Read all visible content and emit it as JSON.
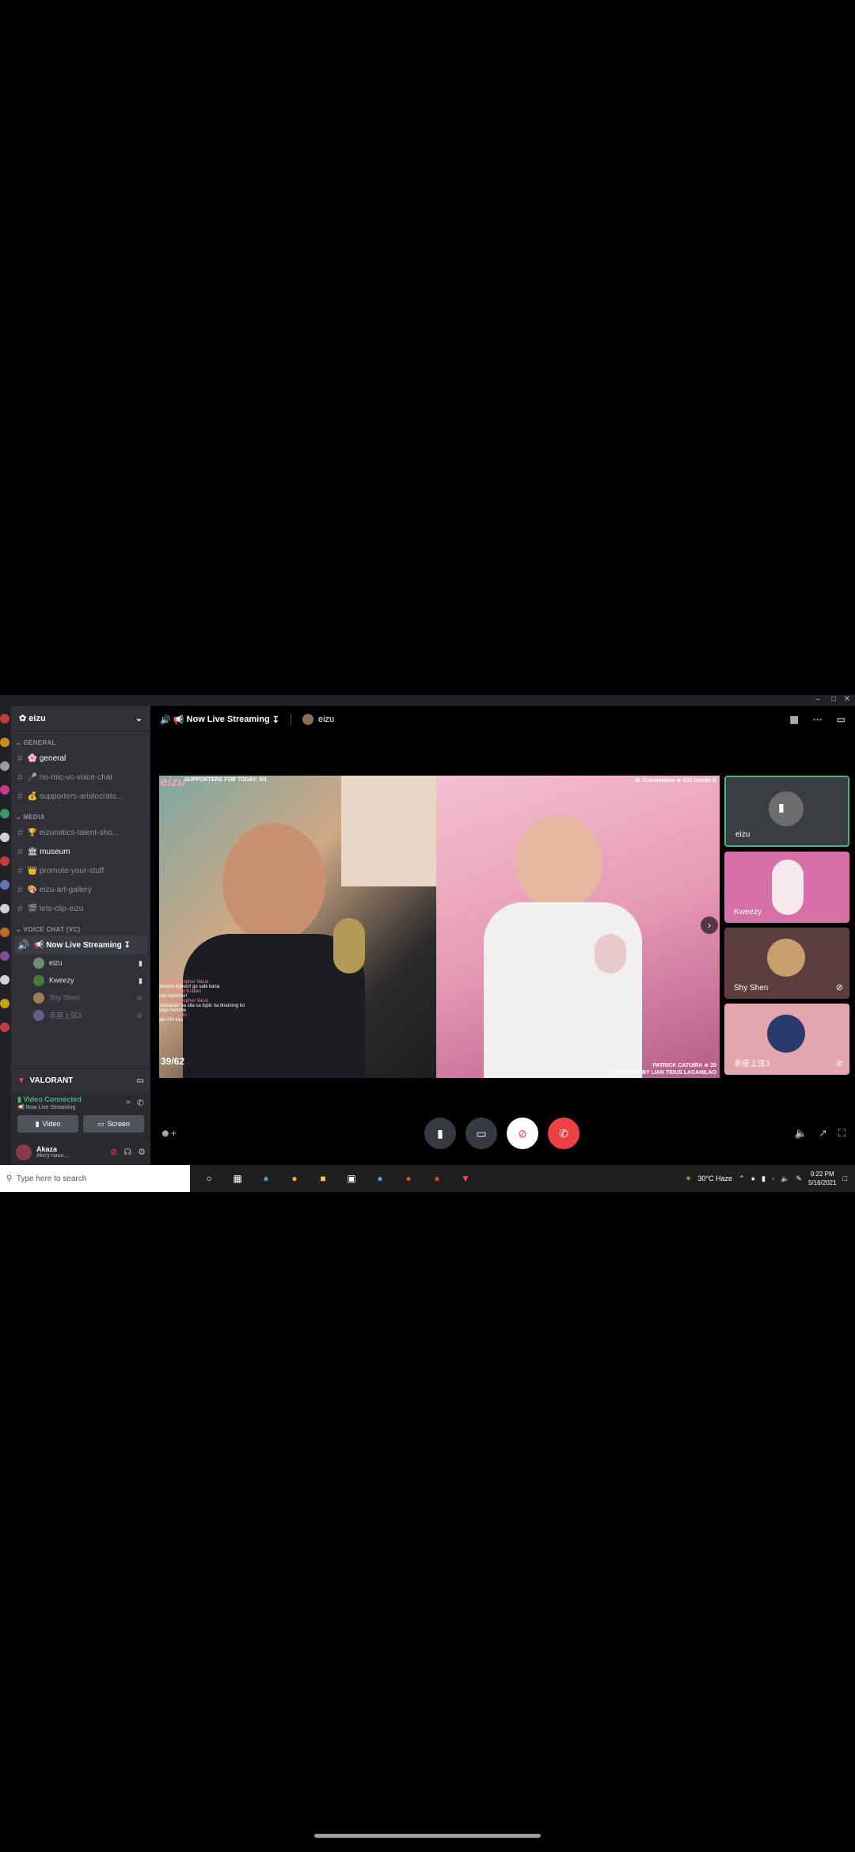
{
  "window": {
    "controls": [
      "–",
      "□",
      "✕"
    ]
  },
  "guild": {
    "name": "eizu"
  },
  "categories": {
    "general": "GENERAL",
    "media": "MEDIA",
    "voice": "VOICE CHAT (VC)"
  },
  "channels_general": [
    {
      "label": "general",
      "emoji": "🌸"
    },
    {
      "label": "no-mic-vc-voice-chat",
      "emoji": "🎤"
    },
    {
      "label": "supporters-aristocrats...",
      "emoji": "💰"
    }
  ],
  "channels_media": [
    {
      "label": "eizunatics-talent-sho...",
      "emoji": "🏆"
    },
    {
      "label": "museum",
      "emoji": "🏛"
    },
    {
      "label": "promote-your-stuff",
      "emoji": "👑"
    },
    {
      "label": "eizu-art-gallery",
      "emoji": "🎨"
    },
    {
      "label": "lets-clip-eizu",
      "emoji": "🎬"
    }
  ],
  "voice_channel": {
    "label": "Now Live Streaming"
  },
  "voice_users": [
    {
      "name": "eizu"
    },
    {
      "name": "Kweezy"
    },
    {
      "name": "Shy Shen"
    },
    {
      "name": "赤座上弦3"
    }
  ],
  "game": {
    "name": "VALORANT"
  },
  "voice_panel": {
    "status": "Video Connected",
    "channel": "Now Live Streaming",
    "video_label": "Video",
    "screen_label": "Screen"
  },
  "user": {
    "name": "Akaza",
    "status": "Ako'y nauu..."
  },
  "main": {
    "channel_title": "Now Live Streaming",
    "streamer": "eizu"
  },
  "stream_overlay": {
    "brand": "eizu",
    "supporters": "SUPPORTERS FOR TODAY: 0/1",
    "top_right": "M. Constantino ★ 235    Dustin B.",
    "counter": "39/62",
    "cheer": "CHEERED BY LIAN TIDUS LACANILAO",
    "cheer_name": "PATRICK CATUIRA ★ 20",
    "chat": [
      {
        "name": "John Christopher Vacal",
        "msg": "sinnnei kraken! go sabi kana"
      },
      {
        "name": "Kraaaahead Kraken",
        "msg": "ban hammer!"
      },
      {
        "name": "John Christopher Vacal",
        "msg": "sumasabi na sila sa topic na tinanong ko sayo hehehe"
      },
      {
        "name": "Jayvee Sotto",
        "msg": "ate PM kita"
      }
    ]
  },
  "tiles": [
    {
      "name": "eizu",
      "muted": false,
      "bg": "#3a3d42"
    },
    {
      "name": "Kweezy",
      "muted": false,
      "bg": "#d76fa8"
    },
    {
      "name": "Shy Shen",
      "muted": true,
      "bg": "#5b3e3d"
    },
    {
      "name": "赤座上弦3",
      "muted": true,
      "bg": "#e3a5ae"
    }
  ],
  "taskbar": {
    "search_placeholder": "Type here to search",
    "weather": "30°C  Haze",
    "time": "9:22 PM",
    "date": "5/16/2021"
  },
  "colors": {
    "accent": "#5865f2",
    "connected": "#43b581",
    "hangup": "#ed4245",
    "tile_active_border": "#43b581"
  }
}
